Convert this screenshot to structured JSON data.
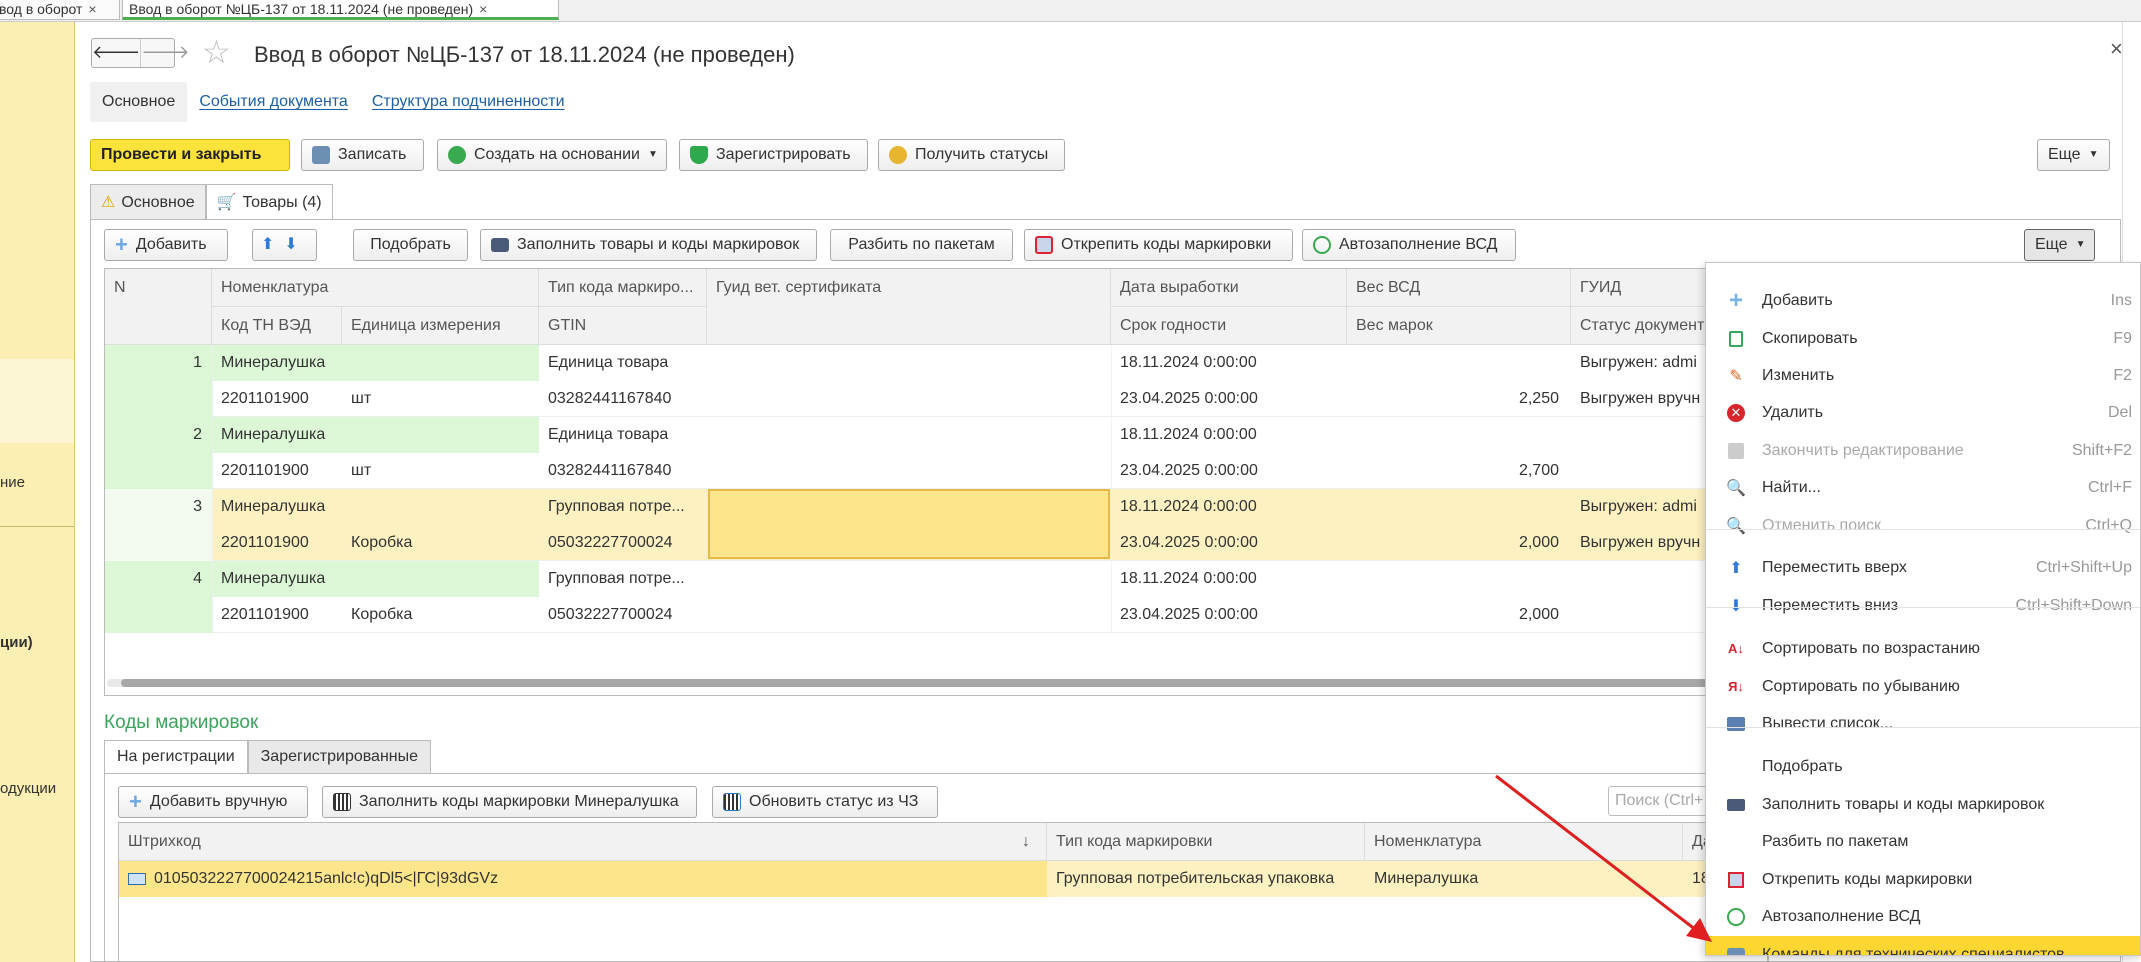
{
  "window_tabs": [
    {
      "label": "вод в оборот",
      "close": "×"
    },
    {
      "label": "Ввод в оборот №ЦБ-137 от 18.11.2024 (не проведен)",
      "close": "×"
    }
  ],
  "sidebar": {
    "labels": [
      "ние",
      "ции)",
      "одукции"
    ]
  },
  "header": {
    "title": "Ввод в оборот №ЦБ-137 от 18.11.2024 (не проведен)",
    "back": "🡐",
    "forward": "🡒",
    "close": "×"
  },
  "doc_tabs": [
    "Основное",
    "События документа",
    "Структура подчиненности"
  ],
  "toolbar": {
    "post_close": "Провести и закрыть",
    "save": "Записать",
    "create_based": "Создать на основании",
    "register": "Зарегистрировать",
    "get_statuses": "Получить статусы",
    "more": "Еще"
  },
  "inner_tabs": [
    "Основное",
    "Товары (4)"
  ],
  "goods_toolbar": {
    "add": "Добавить",
    "pick": "Подобрать",
    "fill": "Заполнить товары и коды маркировок",
    "split": "Разбить по пакетам",
    "detach": "Открепить коды маркировки",
    "autofill": "Автозаполнение ВСД",
    "more": "Еще"
  },
  "grid": {
    "headers_top": [
      "N",
      "Номенклатура",
      "Тип кода маркиро...",
      "Гуид вет. сертификата",
      "Дата выработки",
      "Вес ВСД",
      "ГУИД"
    ],
    "headers_bottom": [
      "Код ТН ВЭД",
      "Единица измерения",
      "GTIN",
      "Срок годности",
      "Вес марок",
      "Статус документ"
    ],
    "rows": [
      {
        "n": "1",
        "name": "Минералушка",
        "code_type": "Единица товара",
        "date": "18.11.2024 0:00:00",
        "status1": "Выгружен: admi",
        "tnved": "2201101900",
        "unit": "шт",
        "gtin": "03282441167840",
        "expiry": "23.04.2025 0:00:00",
        "weight": "2,250",
        "status2": "Выгружен вручн"
      },
      {
        "n": "2",
        "name": "Минералушка",
        "code_type": "Единица товара",
        "date": "18.11.2024 0:00:00",
        "status1": "",
        "tnved": "2201101900",
        "unit": "шт",
        "gtin": "03282441167840",
        "expiry": "23.04.2025 0:00:00",
        "weight": "2,700",
        "status2": ""
      },
      {
        "n": "3",
        "name": "Минералушка",
        "code_type": "Групповая потре...",
        "date": "18.11.2024 0:00:00",
        "status1": "Выгружен: admi",
        "tnved": "2201101900",
        "unit": "Коробка",
        "gtin": "05032227700024",
        "expiry": "23.04.2025 0:00:00",
        "weight": "2,000",
        "status2": "Выгружен вручн"
      },
      {
        "n": "4",
        "name": "Минералушка",
        "code_type": "Групповая потре...",
        "date": "18.11.2024 0:00:00",
        "status1": "",
        "tnved": "2201101900",
        "unit": "Коробка",
        "gtin": "05032227700024",
        "expiry": "23.04.2025 0:00:00",
        "weight": "2,000",
        "status2": ""
      }
    ]
  },
  "codes_section": {
    "title": "Коды маркировок",
    "tabs": [
      "На регистрации",
      "Зарегистрированные"
    ],
    "add_manual": "Добавить вручную",
    "fill_codes": "Заполнить коды маркировки Минералушка",
    "refresh_status": "Обновить статус из ЧЗ",
    "search_placeholder": "Поиск (Ctrl+",
    "headers": [
      "Штрихкод",
      "Тип кода маркировки",
      "Номенклатура",
      "Да"
    ],
    "sort_icon": "↓",
    "rows": [
      {
        "barcode": "0105032227700024215anlc!c)qDl5<|ГС|93dGVz",
        "type": "Групповая потребительская упаковка",
        "name": "Минералушка",
        "date": "18"
      }
    ]
  },
  "context_menu": [
    {
      "label": "Добавить",
      "shortcut": "Ins",
      "icon": "plus-icon",
      "disabled": false
    },
    {
      "label": "Скопировать",
      "shortcut": "F9",
      "icon": "copy-icon",
      "disabled": false
    },
    {
      "label": "Изменить",
      "shortcut": "F2",
      "icon": "pencil-icon",
      "disabled": false
    },
    {
      "label": "Удалить",
      "shortcut": "Del",
      "icon": "delete-icon",
      "disabled": false
    },
    {
      "label": "Закончить редактирование",
      "shortcut": "Shift+F2",
      "icon": "end-edit-icon",
      "disabled": true
    },
    {
      "label": "Найти...",
      "shortcut": "Ctrl+F",
      "icon": "search-icon",
      "disabled": false
    },
    {
      "label": "Отменить поиск",
      "shortcut": "Ctrl+Q",
      "icon": "cancel-search-icon",
      "disabled": true
    },
    {
      "label": "Переместить вверх",
      "shortcut": "Ctrl+Shift+Up",
      "icon": "arrow-up-icon",
      "disabled": false
    },
    {
      "label": "Переместить вниз",
      "shortcut": "Ctrl+Shift+Down",
      "icon": "arrow-down-icon",
      "disabled": false
    },
    {
      "label": "Сортировать по возрастанию",
      "shortcut": "",
      "icon": "sort-asc-icon",
      "disabled": false
    },
    {
      "label": "Сортировать по убыванию",
      "shortcut": "",
      "icon": "sort-desc-icon",
      "disabled": false
    },
    {
      "label": "Вывести список...",
      "shortcut": "",
      "icon": "list-output-icon",
      "disabled": false
    },
    {
      "label": "Подобрать",
      "shortcut": "",
      "icon": "",
      "disabled": false
    },
    {
      "label": "Заполнить товары и коды маркировок",
      "shortcut": "",
      "icon": "barcode-scanner-icon",
      "disabled": false
    },
    {
      "label": "Разбить по пакетам",
      "shortcut": "",
      "icon": "",
      "disabled": false
    },
    {
      "label": "Открепить коды маркировки",
      "shortcut": "",
      "icon": "detach-icon",
      "disabled": false
    },
    {
      "label": "Автозаполнение ВСД",
      "shortcut": "",
      "icon": "check-circle-icon",
      "disabled": false
    },
    {
      "label": "Команды для технических специалистов",
      "shortcut": "",
      "icon": "tech-icon",
      "disabled": false,
      "highlighted": true
    }
  ],
  "colors": {
    "primary_button": "#fce33c",
    "sidebar": "#fbefb3",
    "row_green": "#dcf7d6",
    "row_selected": "#fdf1c2",
    "cell_current": "#fde58b",
    "menu_highlight": "#fdd631",
    "link": "#1f5fa8",
    "section_title": "#3aa55d",
    "arrow": "#e02020"
  }
}
